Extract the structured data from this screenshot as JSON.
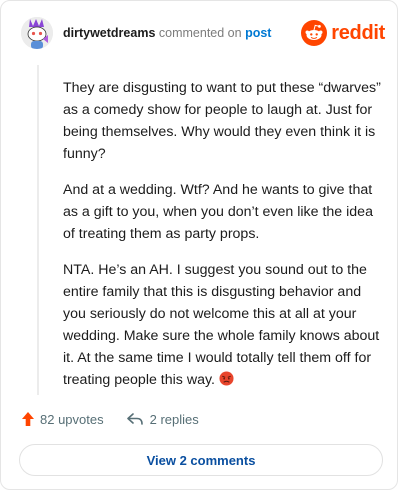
{
  "header": {
    "username": "dirtywetdreams",
    "action_text": "commented on",
    "post_link": "post",
    "logo_text": "reddit",
    "avatar_icon": "snoo-avatar-icon"
  },
  "comment": {
    "paragraphs": [
      "They are disgusting to want to put these “dwarves” as a comedy show for people to laugh at. Just for being themselves. Why would they even think it is funny?",
      "And at a wedding. Wtf? And he wants to give that as a gift to you, when you don’t even like the idea of treating them as party props.",
      "NTA. He’s an AH. I suggest you sound out to the entire family that this is disgusting behavior and you seriously do not welcome this at all at your wedding. Make sure the whole family knows about it. At the same time I would totally tell them off for treating people this way."
    ],
    "emoji": "angry-face-emoji"
  },
  "footer": {
    "upvotes_label": "82 upvotes",
    "replies_label": "2 replies",
    "view_comments_label": "View 2 comments"
  },
  "colors": {
    "brand": "#ff4500",
    "link": "#0079d3",
    "button_text": "#0a4fa0"
  }
}
